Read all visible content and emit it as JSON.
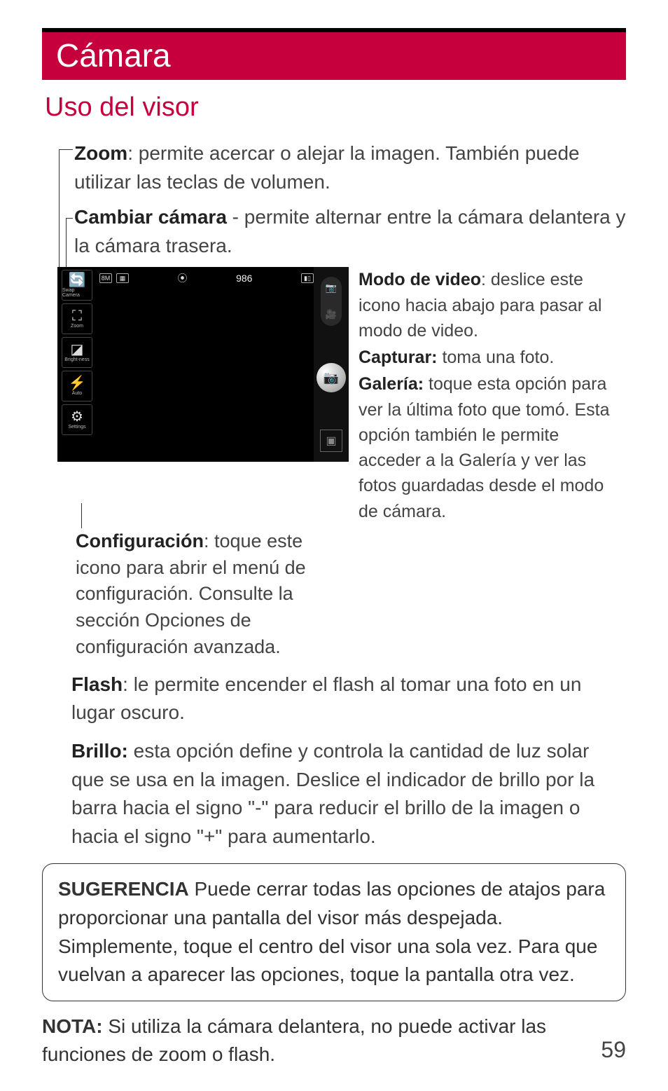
{
  "header": {
    "title": "Cámara"
  },
  "section_title": "Uso del visor",
  "callouts": {
    "zoom": {
      "term": "Zoom",
      "text": ": permite acercar o alejar la imagen. También puede utilizar las teclas de volumen."
    },
    "swap": {
      "term": "Cambiar cámara",
      "text": " - permite alternar entre la cámara delantera y la cámara trasera."
    },
    "video": {
      "term": "Modo de video",
      "text": ": deslice este icono hacia abajo para pasar al modo de video."
    },
    "capture": {
      "term": "Capturar:",
      "text": " toma una foto."
    },
    "gallery": {
      "term": "Galería:",
      "text": " toque esta opción para ver la última foto que tomó. Esta opción también le permite acceder a la Galería y ver las fotos guardadas desde el modo de cámara."
    },
    "settings": {
      "term": "Configuración",
      "text": ": toque este icono para abrir el menú de configuración. Consulte la sección Opciones de configuración avanzada."
    },
    "flash": {
      "term": "Flash",
      "text": ": le permite encender el flash al tomar una foto en un lugar oscuro."
    },
    "brillo": {
      "term": "Brillo:",
      "text": " esta opción define y controla la cantidad de luz solar que se usa en la imagen. Deslice el indicador de brillo por la barra hacia el signo \"-\" para reducir el brillo de la imagen o hacia el signo \"+\" para aumentarlo."
    }
  },
  "tip": {
    "term": "SUGERENCIA",
    "text": " Puede cerrar todas las opciones de atajos para proporcionar una pantalla del visor más despejada. Simplemente, toque el centro del visor una sola vez. Para que vuelvan a aparecer las opciones, toque la pantalla otra vez."
  },
  "note": {
    "term": "NOTA:",
    "text": " Si utiliza la cámara delantera, no puede activar las funciones de zoom o flash."
  },
  "viewfinder": {
    "shots_remaining": "986",
    "left_buttons": {
      "swap": "Swap Camera",
      "zoom": "Zoom",
      "brightness": "Bright-ness",
      "auto": "Auto",
      "settings": "Settings"
    }
  },
  "page_number": "59"
}
